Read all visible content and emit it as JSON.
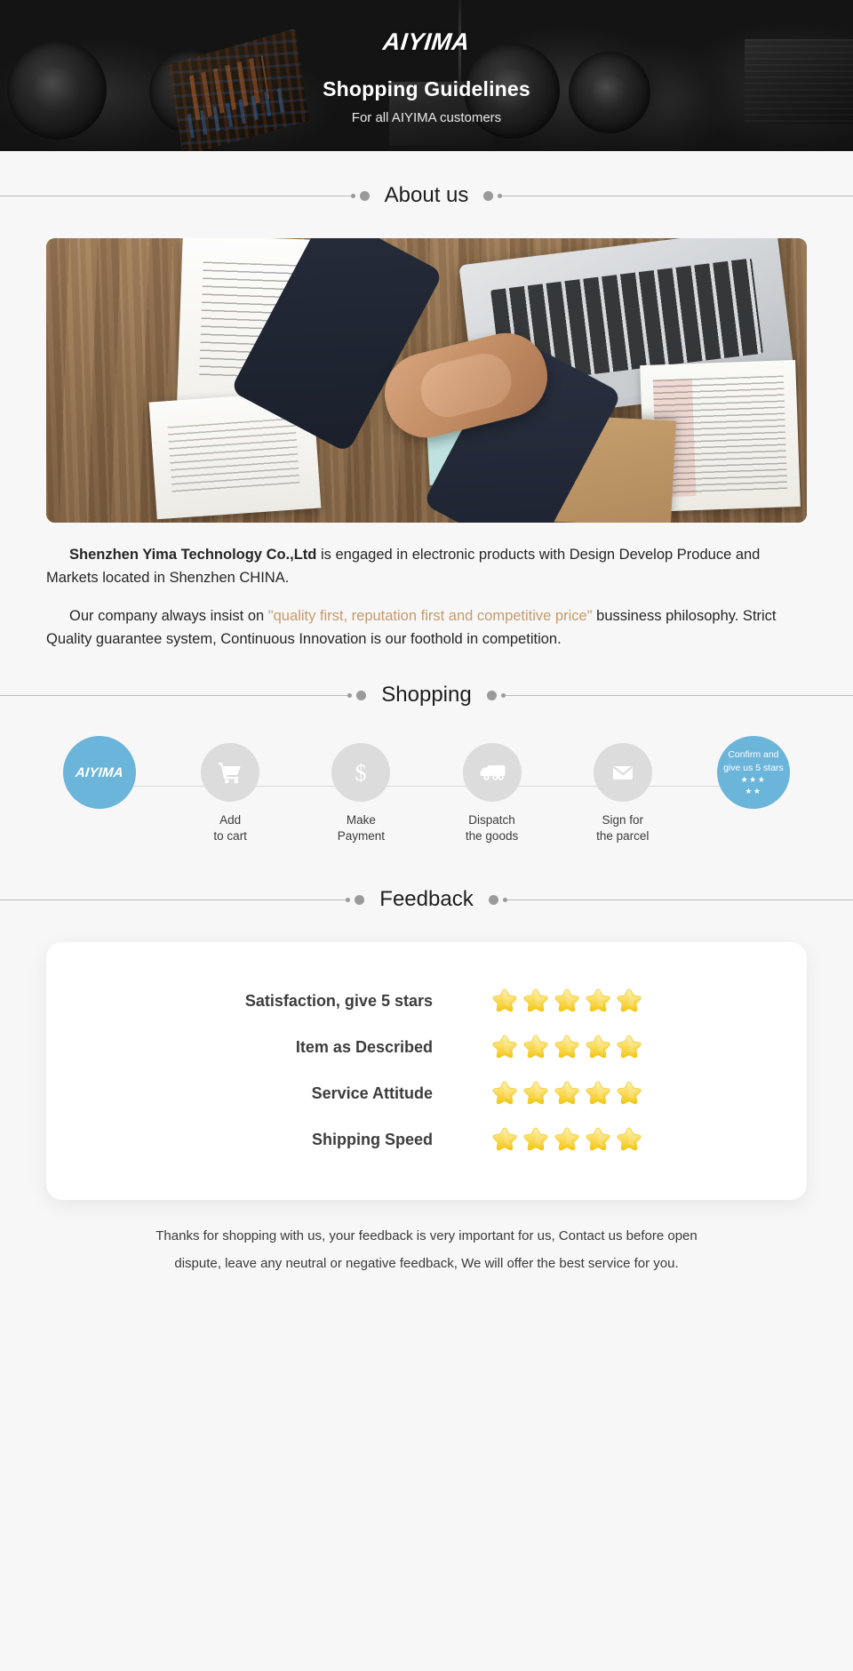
{
  "hero": {
    "logo": "AIYIMA",
    "title": "Shopping Guidelines",
    "subtitle": "For all AIYIMA customers"
  },
  "sections": {
    "about_title": "About us",
    "shopping_title": "Shopping",
    "feedback_title": "Feedback"
  },
  "about": {
    "p1_strong": "Shenzhen Yima Technology Co.,Ltd",
    "p1_rest": " is engaged in electronic products with Design Develop Produce and Markets located in Shenzhen CHINA.",
    "p2_before": "Our company always insist on ",
    "p2_quote": "\"quality first, reputation first and competitive price\"",
    "p2_after": " bussiness philosophy. Strict Quality guarantee system, Continuous Innovation is our foothold in competition."
  },
  "shopping": {
    "steps": [
      {
        "id": "brand",
        "icon": "aiyima-logo-icon",
        "brand": "AIYIMA",
        "label": ""
      },
      {
        "id": "cart",
        "icon": "shopping-cart-icon",
        "label": "Add\nto cart"
      },
      {
        "id": "payment",
        "icon": "dollar-icon",
        "label": "Make\nPayment"
      },
      {
        "id": "dispatch",
        "icon": "truck-icon",
        "label": "Dispatch\nthe goods"
      },
      {
        "id": "sign",
        "icon": "envelope-icon",
        "label": "Sign for\nthe parcel"
      },
      {
        "id": "confirm",
        "icon": "stars-icon",
        "label": "",
        "badge_line1": "Confirm and",
        "badge_line2": "give us 5 stars",
        "badge_stars_row1": "★★★",
        "badge_stars_row2": "★★"
      }
    ]
  },
  "feedback": {
    "rows": [
      {
        "label": "Satisfaction, give 5 stars",
        "stars": 5
      },
      {
        "label": "Item as Described",
        "stars": 5
      },
      {
        "label": "Service Attitude",
        "stars": 5
      },
      {
        "label": "Shipping Speed",
        "stars": 5
      }
    ],
    "footer_line1": "Thanks for shopping with us, your feedback is very important for us, Contact us before open",
    "footer_line2": "dispute, leave any neutral or negative feedback, We will offer the best service for you."
  },
  "colors": {
    "brand_blue": "#6bb5da",
    "accent_quote": "#c79a6b",
    "page_bg": "#f7f7f7",
    "hero_bg": "#151515",
    "star_gold": "#f7d44c"
  }
}
